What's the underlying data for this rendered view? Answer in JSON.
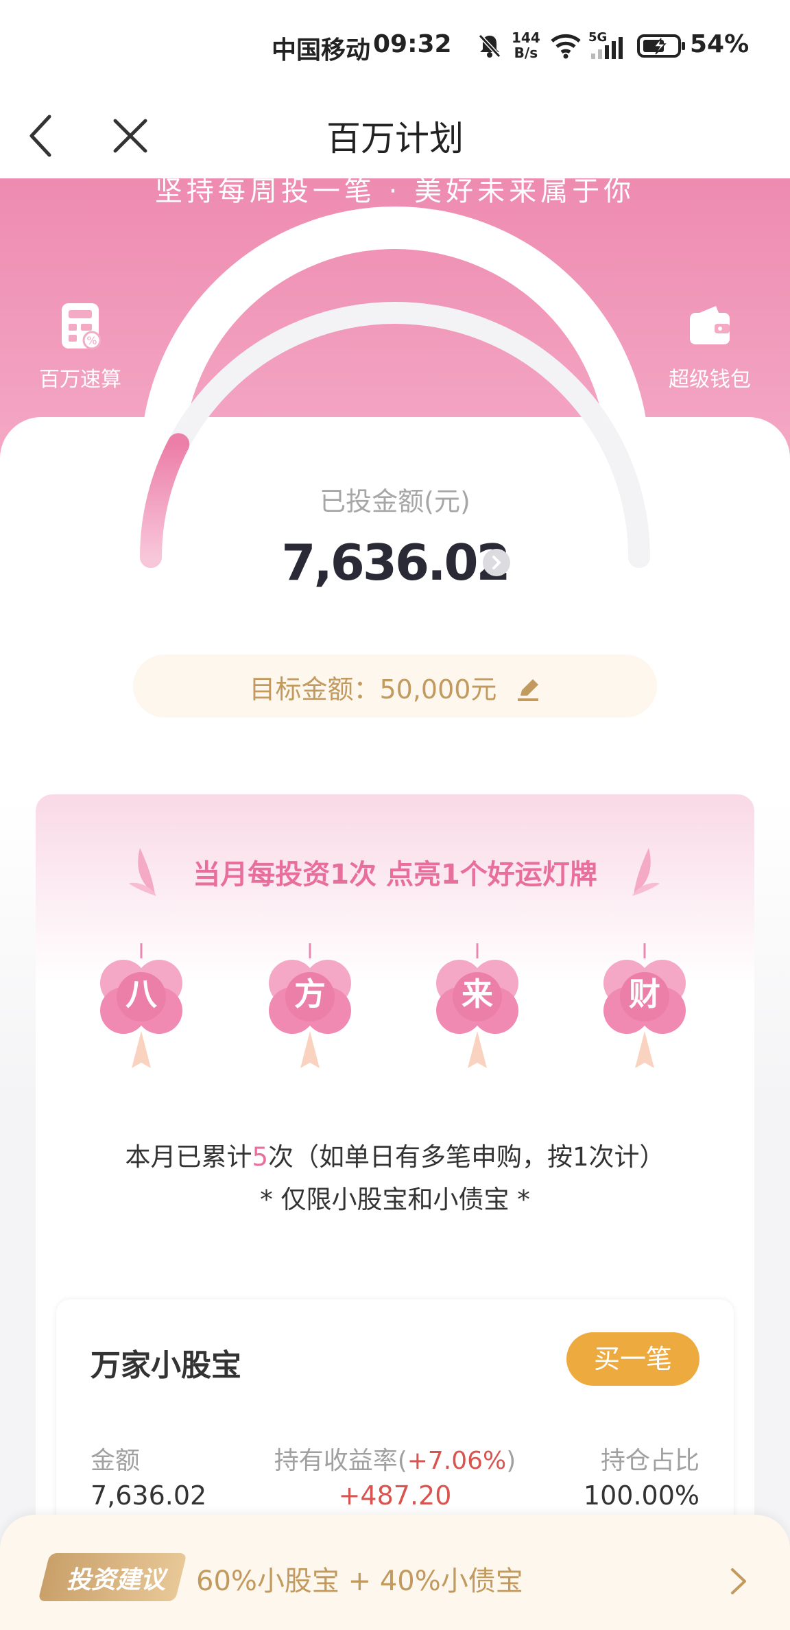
{
  "status": {
    "carrier": "中国移动",
    "time": "09:32",
    "net_speed_top": "144",
    "net_speed_bottom": "B/s",
    "network": "5G",
    "battery": "54%"
  },
  "nav": {
    "title": "百万计划",
    "back_icon": "chevron-left-icon",
    "close_icon": "close-icon"
  },
  "hero": {
    "slogan": "坚持每周投一笔 · 美好未来属于你",
    "left_action": {
      "label": "百万速算",
      "icon": "calculator-icon"
    },
    "right_action": {
      "label": "超级钱包",
      "icon": "wallet-icon"
    }
  },
  "progress": {
    "invested_label": "已投金额(元)",
    "invested_value": "7,636.02",
    "fraction": 0.153,
    "target_text": "目标金额：50,000元"
  },
  "lucky": {
    "headline": "当月每投资1次 点亮1个好运灯牌",
    "lanterns": [
      "八",
      "方",
      "来",
      "财"
    ],
    "count_prefix": "本月已累计",
    "count_num": "5",
    "count_suffix": "次（如单日有多笔申购，按1次计）",
    "limit_text": "* 仅限小股宝和小债宝 *"
  },
  "fund": {
    "name": "万家小股宝",
    "buy_label": "买一笔",
    "amount_label": "金额",
    "amount_value": "7,636.02",
    "rate_label_prefix": "持有收益率(",
    "rate_pct": "+7.06%",
    "rate_label_suffix": ")",
    "rate_value": "+487.20",
    "ratio_label": "持仓占比",
    "ratio_value": "100.00%"
  },
  "advice": {
    "badge": "投资建议",
    "text": "60%小股宝 + 40%小债宝"
  },
  "colors": {
    "pink": "#ee8bb0",
    "gold": "#c29a5e",
    "orange_button": "#edab3f",
    "loss_red": "#d9534f"
  }
}
